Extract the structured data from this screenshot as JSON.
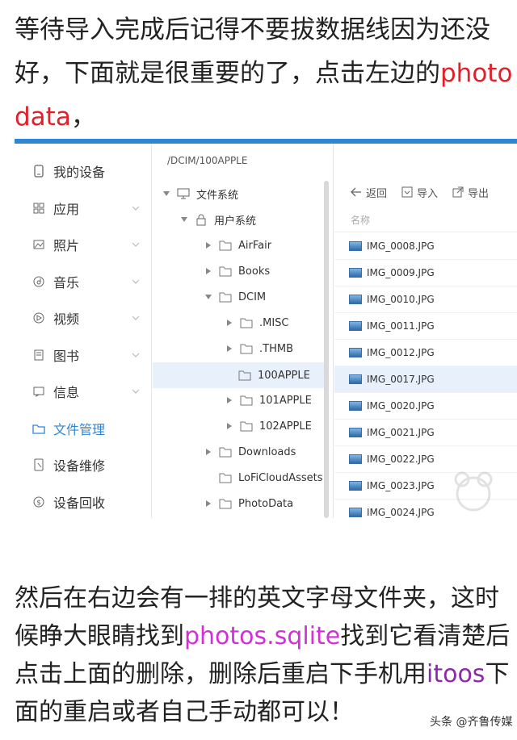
{
  "intro": {
    "text_a": "等待导入完成后记得不要拔数据线因为还没好，下面就是很重要的了，点击左边的",
    "highlight": "photo data",
    "text_b": "，"
  },
  "sidebar": {
    "items": [
      {
        "label": "我的设备",
        "icon": "phone-icon",
        "chevron": false
      },
      {
        "label": "应用",
        "icon": "apps-grid-icon",
        "chevron": true
      },
      {
        "label": "照片",
        "icon": "photo-icon",
        "chevron": true
      },
      {
        "label": "音乐",
        "icon": "music-icon",
        "chevron": true
      },
      {
        "label": "视频",
        "icon": "video-icon",
        "chevron": true
      },
      {
        "label": "图书",
        "icon": "book-icon",
        "chevron": true
      },
      {
        "label": "信息",
        "icon": "message-icon",
        "chevron": true
      },
      {
        "label": "文件管理",
        "icon": "folder-icon",
        "chevron": false,
        "active": true
      },
      {
        "label": "设备维修",
        "icon": "repair-icon",
        "chevron": false
      },
      {
        "label": "设备回收",
        "icon": "recycle-icon",
        "chevron": false
      }
    ]
  },
  "tree": {
    "path": "/DCIM/100APPLE",
    "nodes": [
      {
        "label": "文件系统",
        "icon": "monitor-icon",
        "expanded": true
      },
      {
        "label": "用户系统",
        "icon": "lock-icon",
        "expanded": true
      },
      {
        "label": "AirFair",
        "icon": "folder-icon",
        "expanded": false
      },
      {
        "label": "Books",
        "icon": "folder-icon",
        "expanded": false
      },
      {
        "label": "DCIM",
        "icon": "folder-icon",
        "expanded": true
      },
      {
        "label": ".MISC",
        "icon": "folder-icon",
        "expanded": false
      },
      {
        "label": ".THMB",
        "icon": "folder-icon",
        "expanded": false
      },
      {
        "label": "100APPLE",
        "icon": "folder-icon",
        "selected": true
      },
      {
        "label": "101APPLE",
        "icon": "folder-icon",
        "expanded": false
      },
      {
        "label": "102APPLE",
        "icon": "folder-icon",
        "expanded": false
      },
      {
        "label": "Downloads",
        "icon": "folder-icon",
        "expanded": false
      },
      {
        "label": "LoFiCloudAssets",
        "icon": "folder-icon"
      },
      {
        "label": "PhotoData",
        "icon": "folder-icon",
        "expanded": false
      }
    ]
  },
  "toolbar": {
    "back": "返回",
    "import": "导入",
    "export": "导出"
  },
  "files": {
    "column": "名称",
    "rows": [
      "IMG_0008.JPG",
      "IMG_0009.JPG",
      "IMG_0010.JPG",
      "IMG_0011.JPG",
      "IMG_0012.JPG",
      "IMG_0017.JPG",
      "IMG_0020.JPG",
      "IMG_0021.JPG",
      "IMG_0022.JPG",
      "IMG_0023.JPG",
      "IMG_0024.JPG"
    ],
    "selected_index": 5
  },
  "outro": {
    "text_a": "然后在右边会有一排的英文字母文件夹，这时候睁大眼睛找到",
    "hl1": "photos.sqlite",
    "text_b": "找到它看清楚后点击上面的删除，删除后重启下手机用",
    "hl2": "itoos",
    "text_c": "下面的重启或者自己手动都可以！"
  },
  "footer": "头条 @齐鲁传媒",
  "colors": {
    "accent": "#2f86d6",
    "red": "#e0202a",
    "pink": "#d130d6",
    "purple": "#8a2aa8"
  }
}
